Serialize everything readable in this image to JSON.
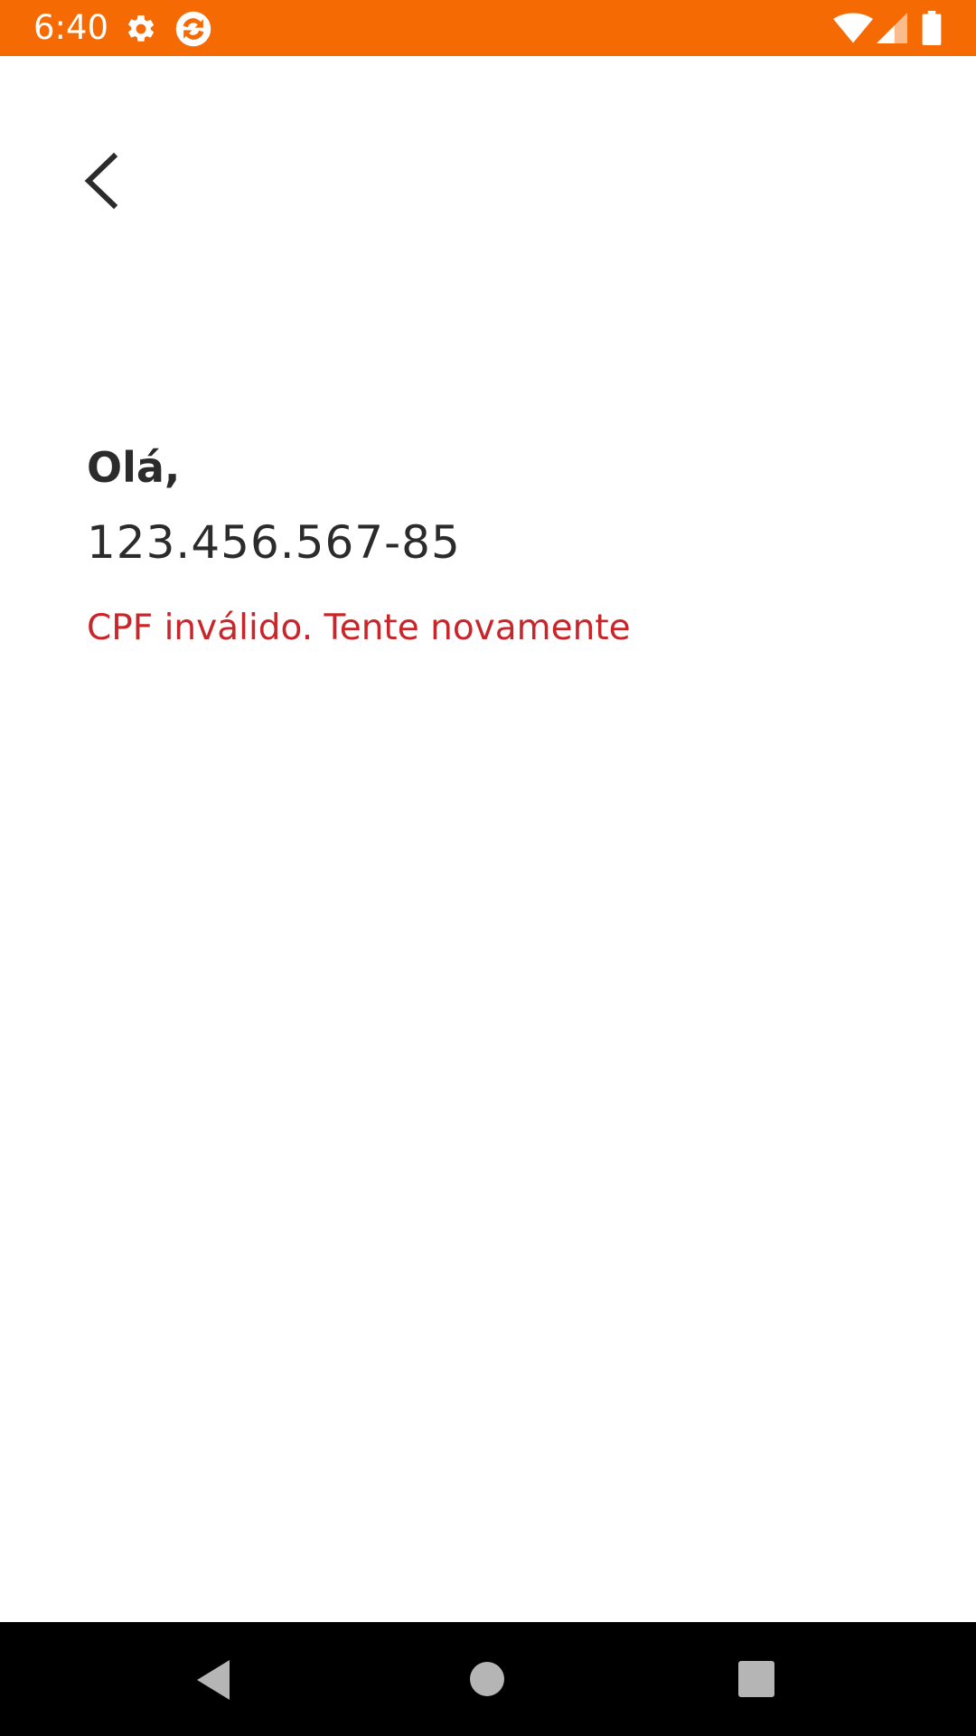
{
  "status_bar": {
    "time": "6:40",
    "background_color": "#f66a03",
    "left_icons": [
      "settings-gear-icon",
      "app-notification-icon"
    ],
    "right_icons": [
      "wifi-icon",
      "cell-signal-icon",
      "battery-icon"
    ]
  },
  "header": {
    "back_icon": "chevron-left-icon"
  },
  "main": {
    "greeting": "Olá,",
    "cpf": "123.456.567-85",
    "error": "CPF inválido. Tente novamente",
    "error_color": "#c8262b",
    "text_color": "#2b2b2b"
  },
  "nav_bar": {
    "buttons": [
      "back-triangle-icon",
      "home-circle-icon",
      "recents-square-icon"
    ]
  }
}
